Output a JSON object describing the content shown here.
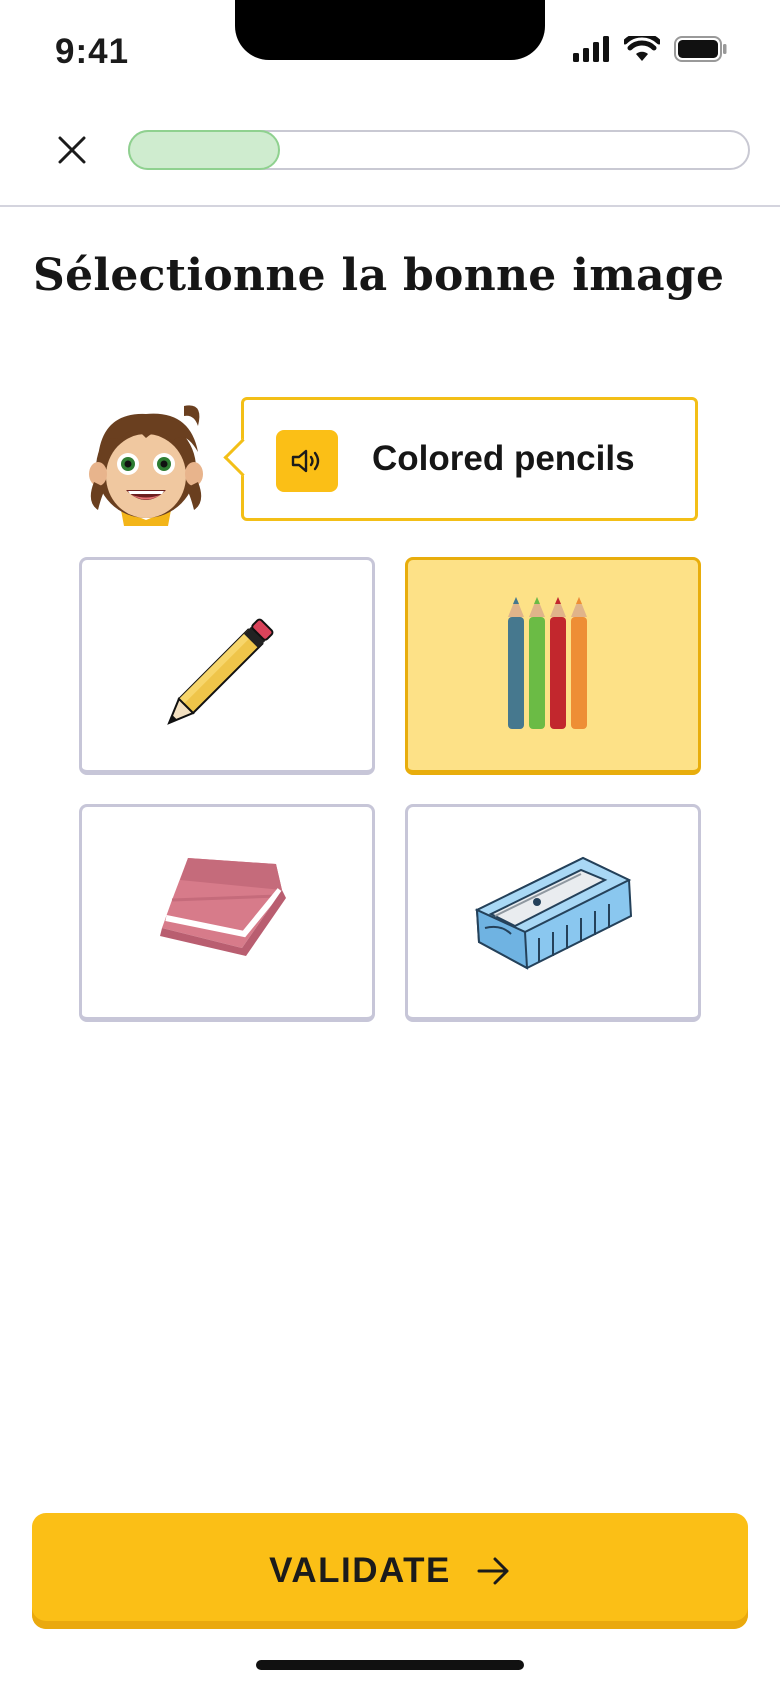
{
  "status_bar": {
    "time": "9:41",
    "icons": [
      "cellular-icon",
      "wifi-icon",
      "battery-icon"
    ]
  },
  "header": {
    "close_icon": "close-icon",
    "progress_fraction": 0.24
  },
  "instruction": "Sélectionne la bonne image",
  "prompt": {
    "word": "Colored pencils",
    "audio_icon": "speaker-icon",
    "mascot": "boy-face-mascot"
  },
  "choices": [
    {
      "name": "pencil",
      "selected": false
    },
    {
      "name": "colored-pencils",
      "selected": true
    },
    {
      "name": "eraser",
      "selected": false
    },
    {
      "name": "sharpener",
      "selected": false
    }
  ],
  "validate": {
    "label": "VALIDATE",
    "icon": "arrow-right-icon"
  },
  "colors": {
    "accent": "#fbbf16",
    "selected_card": "#fde187",
    "progress_fill": "#cfeccf",
    "card_border": "#c7c6d8"
  }
}
